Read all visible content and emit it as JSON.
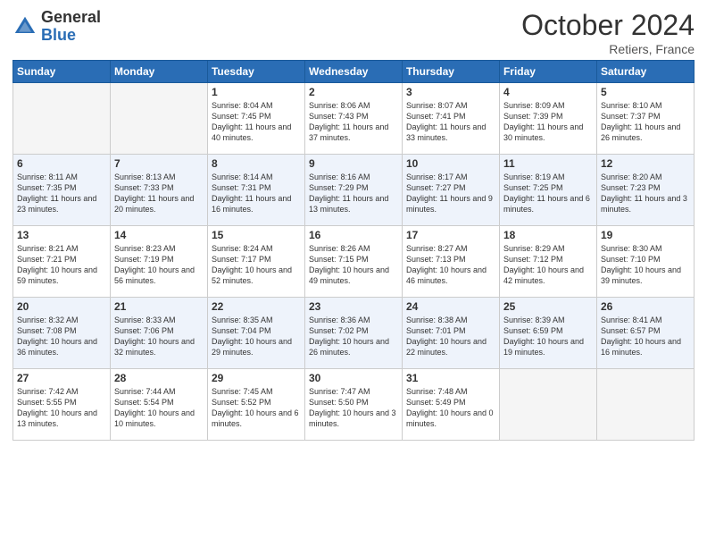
{
  "header": {
    "logo_general": "General",
    "logo_blue": "Blue",
    "month_title": "October 2024",
    "location": "Retiers, France"
  },
  "days_of_week": [
    "Sunday",
    "Monday",
    "Tuesday",
    "Wednesday",
    "Thursday",
    "Friday",
    "Saturday"
  ],
  "weeks": [
    [
      {
        "day": "",
        "info": ""
      },
      {
        "day": "",
        "info": ""
      },
      {
        "day": "1",
        "info": "Sunrise: 8:04 AM\nSunset: 7:45 PM\nDaylight: 11 hours and 40 minutes."
      },
      {
        "day": "2",
        "info": "Sunrise: 8:06 AM\nSunset: 7:43 PM\nDaylight: 11 hours and 37 minutes."
      },
      {
        "day": "3",
        "info": "Sunrise: 8:07 AM\nSunset: 7:41 PM\nDaylight: 11 hours and 33 minutes."
      },
      {
        "day": "4",
        "info": "Sunrise: 8:09 AM\nSunset: 7:39 PM\nDaylight: 11 hours and 30 minutes."
      },
      {
        "day": "5",
        "info": "Sunrise: 8:10 AM\nSunset: 7:37 PM\nDaylight: 11 hours and 26 minutes."
      }
    ],
    [
      {
        "day": "6",
        "info": "Sunrise: 8:11 AM\nSunset: 7:35 PM\nDaylight: 11 hours and 23 minutes."
      },
      {
        "day": "7",
        "info": "Sunrise: 8:13 AM\nSunset: 7:33 PM\nDaylight: 11 hours and 20 minutes."
      },
      {
        "day": "8",
        "info": "Sunrise: 8:14 AM\nSunset: 7:31 PM\nDaylight: 11 hours and 16 minutes."
      },
      {
        "day": "9",
        "info": "Sunrise: 8:16 AM\nSunset: 7:29 PM\nDaylight: 11 hours and 13 minutes."
      },
      {
        "day": "10",
        "info": "Sunrise: 8:17 AM\nSunset: 7:27 PM\nDaylight: 11 hours and 9 minutes."
      },
      {
        "day": "11",
        "info": "Sunrise: 8:19 AM\nSunset: 7:25 PM\nDaylight: 11 hours and 6 minutes."
      },
      {
        "day": "12",
        "info": "Sunrise: 8:20 AM\nSunset: 7:23 PM\nDaylight: 11 hours and 3 minutes."
      }
    ],
    [
      {
        "day": "13",
        "info": "Sunrise: 8:21 AM\nSunset: 7:21 PM\nDaylight: 10 hours and 59 minutes."
      },
      {
        "day": "14",
        "info": "Sunrise: 8:23 AM\nSunset: 7:19 PM\nDaylight: 10 hours and 56 minutes."
      },
      {
        "day": "15",
        "info": "Sunrise: 8:24 AM\nSunset: 7:17 PM\nDaylight: 10 hours and 52 minutes."
      },
      {
        "day": "16",
        "info": "Sunrise: 8:26 AM\nSunset: 7:15 PM\nDaylight: 10 hours and 49 minutes."
      },
      {
        "day": "17",
        "info": "Sunrise: 8:27 AM\nSunset: 7:13 PM\nDaylight: 10 hours and 46 minutes."
      },
      {
        "day": "18",
        "info": "Sunrise: 8:29 AM\nSunset: 7:12 PM\nDaylight: 10 hours and 42 minutes."
      },
      {
        "day": "19",
        "info": "Sunrise: 8:30 AM\nSunset: 7:10 PM\nDaylight: 10 hours and 39 minutes."
      }
    ],
    [
      {
        "day": "20",
        "info": "Sunrise: 8:32 AM\nSunset: 7:08 PM\nDaylight: 10 hours and 36 minutes."
      },
      {
        "day": "21",
        "info": "Sunrise: 8:33 AM\nSunset: 7:06 PM\nDaylight: 10 hours and 32 minutes."
      },
      {
        "day": "22",
        "info": "Sunrise: 8:35 AM\nSunset: 7:04 PM\nDaylight: 10 hours and 29 minutes."
      },
      {
        "day": "23",
        "info": "Sunrise: 8:36 AM\nSunset: 7:02 PM\nDaylight: 10 hours and 26 minutes."
      },
      {
        "day": "24",
        "info": "Sunrise: 8:38 AM\nSunset: 7:01 PM\nDaylight: 10 hours and 22 minutes."
      },
      {
        "day": "25",
        "info": "Sunrise: 8:39 AM\nSunset: 6:59 PM\nDaylight: 10 hours and 19 minutes."
      },
      {
        "day": "26",
        "info": "Sunrise: 8:41 AM\nSunset: 6:57 PM\nDaylight: 10 hours and 16 minutes."
      }
    ],
    [
      {
        "day": "27",
        "info": "Sunrise: 7:42 AM\nSunset: 5:55 PM\nDaylight: 10 hours and 13 minutes."
      },
      {
        "day": "28",
        "info": "Sunrise: 7:44 AM\nSunset: 5:54 PM\nDaylight: 10 hours and 10 minutes."
      },
      {
        "day": "29",
        "info": "Sunrise: 7:45 AM\nSunset: 5:52 PM\nDaylight: 10 hours and 6 minutes."
      },
      {
        "day": "30",
        "info": "Sunrise: 7:47 AM\nSunset: 5:50 PM\nDaylight: 10 hours and 3 minutes."
      },
      {
        "day": "31",
        "info": "Sunrise: 7:48 AM\nSunset: 5:49 PM\nDaylight: 10 hours and 0 minutes."
      },
      {
        "day": "",
        "info": ""
      },
      {
        "day": "",
        "info": ""
      }
    ]
  ]
}
